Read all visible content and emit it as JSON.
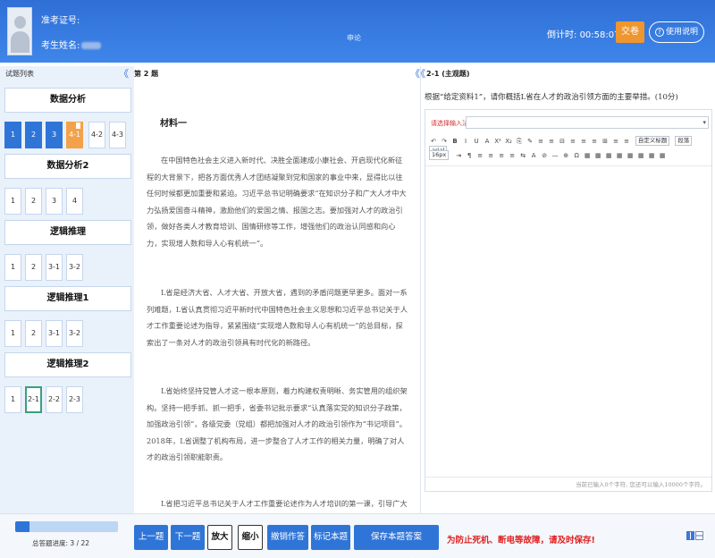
{
  "header": {
    "exam_id_label": "准考证号:",
    "name_label": "考生姓名:",
    "subject": "申论",
    "countdown_label": "倒计时:",
    "countdown_value": "00:58:07",
    "submit_label": "交卷",
    "help_label": "使用说明"
  },
  "left": {
    "title": "试题列表",
    "collapse": "《",
    "sections": [
      {
        "title": "数据分析",
        "items": [
          {
            "label": "1",
            "state": "done"
          },
          {
            "label": "2",
            "state": "done"
          },
          {
            "label": "3",
            "state": "done"
          },
          {
            "label": "4-1",
            "state": "marked"
          },
          {
            "label": "4-2",
            "state": "normal"
          },
          {
            "label": "4-3",
            "state": "normal"
          }
        ]
      },
      {
        "title": "数据分析2",
        "items": [
          {
            "label": "1",
            "state": "normal"
          },
          {
            "label": "2",
            "state": "normal"
          },
          {
            "label": "3",
            "state": "normal"
          },
          {
            "label": "4",
            "state": "normal"
          }
        ]
      },
      {
        "title": "逻辑推理",
        "items": [
          {
            "label": "1",
            "state": "normal"
          },
          {
            "label": "2",
            "state": "normal"
          },
          {
            "label": "3-1",
            "state": "normal"
          },
          {
            "label": "3-2",
            "state": "normal"
          }
        ]
      },
      {
        "title": "逻辑推理1",
        "items": [
          {
            "label": "1",
            "state": "normal"
          },
          {
            "label": "2",
            "state": "normal"
          },
          {
            "label": "3-1",
            "state": "normal"
          },
          {
            "label": "3-2",
            "state": "normal"
          }
        ]
      },
      {
        "title": "逻辑推理2",
        "items": [
          {
            "label": "1",
            "state": "normal"
          },
          {
            "label": "2-1",
            "state": "current"
          },
          {
            "label": "2-2",
            "state": "normal"
          },
          {
            "label": "2-3",
            "state": "normal"
          }
        ]
      }
    ]
  },
  "middle": {
    "title": "第 2 题",
    "collapse": "《",
    "material_title": "材料一",
    "paragraphs": [
      "在中国特色社会主义进入新时代、决胜全面建成小康社会、开启现代化新征程的大背景下，把各方面优秀人才团结凝聚到党和国家的事业中来，显得比以往任何时候都更加重要和紧迫。习近平总书记明确要求“在知识分子和广大人才中大力弘扬爱国奋斗精神，激励他们的爱国之情、报国之志。要加强对人才的政治引领，做好各类人才教育培训、国情研修等工作，增强他们的政治认同感和向心力，实现增人数和导人心有机统一”。",
      "L省是经济大省、人才大省、开放大省，遇到的矛盾问题更早更多。面对一系列难题，L省认真贯彻习近平新时代中国特色社会主义思想和习近平总书记关于人才工作重要论述为指导，紧紧围绕“实现增人数和导人心有机统一”的总目标，探索出了一条对人才的政治引领具有时代化的新路径。",
      "L省始终坚持党管人才这一根本原则，着力构建权责明晰、务实管用的组织架构。坚持一把手抓、抓一把手，省委书记批示要求“认真落实党的知识分子政策，加强政治引领”，各级党委（党组）都把加强对人才的政治引领作为“书记项目”。2018年，L省调整了机构布局，进一步整合了人才工作的相关力量，明确了对人才的政治引领职能职责。",
      "L省把习近平总书记关于人才工作重要论述作为人才培训的第一课，引导广大人才同"
    ]
  },
  "right": {
    "title": "2-1 (主观题)",
    "collapse": "《",
    "question": "根据“给定资料1”，请你概括L省在人才的政治引领方面的主要举措。(10分)",
    "input_method_label": "请选择输入法",
    "input_method_value": "",
    "toolbar_row1": [
      "↶",
      "↷",
      "B",
      "I",
      "U",
      "A",
      "X²",
      "X₂",
      "⎘",
      "✎",
      "≡",
      "≡",
      "⊟",
      "≡",
      "≡",
      "≡",
      "⊞",
      "≡",
      "≡"
    ],
    "para_format_label": "自定义标题",
    "paragraph_label": "段落",
    "font_label": "arial",
    "font_size_label": "16px",
    "toolbar_row2": [
      "⇥",
      "¶",
      "≡",
      "≡",
      "≡",
      "≡",
      "⇆",
      "A",
      "⊘",
      "—",
      "⊕",
      "Ω",
      "▦",
      "▦",
      "▦",
      "▦",
      "▦",
      "▦",
      "▦",
      "▦"
    ],
    "word_count_text": "当前已输入0个字符, 您还可以输入10000个字符。"
  },
  "bottom": {
    "progress_label": "总答题进度: 3 / 22",
    "progress_fraction": 0.136,
    "buttons": {
      "prev": "上一题",
      "next": "下一题",
      "zoom_in": "放大",
      "zoom_out": "缩小",
      "undo": "撤销作答",
      "mark": "标记本题",
      "save": "保存本题答案（Ctrl+S）"
    },
    "warning": "为防止死机、断电等故障，请及时保存!"
  },
  "colors": {
    "header_blue": "#3f86ea",
    "done_blue": "#2f75d8",
    "marked_orange": "#f3a24a",
    "current_green": "#3aa07a",
    "warning_red": "#e02020"
  }
}
